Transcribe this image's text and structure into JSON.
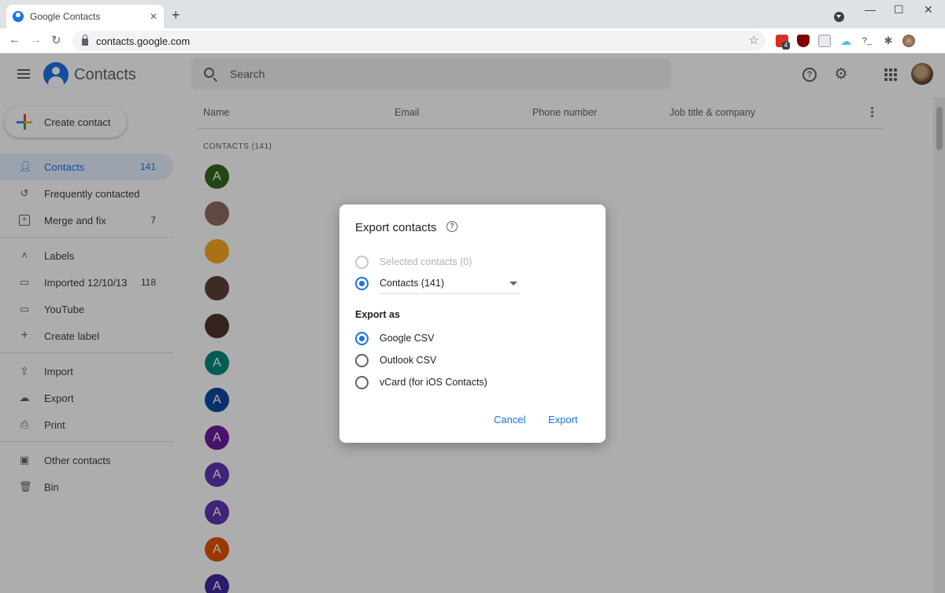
{
  "browser": {
    "tab_title": "Google Contacts",
    "tab_close": "✕",
    "new_tab": "+",
    "url": "contacts.google.com",
    "win_min": "—",
    "win_max": "☐",
    "win_close": "✕",
    "ext_badge": "4"
  },
  "header": {
    "app_name": "Contacts",
    "search_placeholder": "Search"
  },
  "sidebar": {
    "create_label": "Create contact",
    "items": [
      {
        "label": "Contacts",
        "count": "141"
      },
      {
        "label": "Frequently contacted",
        "count": ""
      },
      {
        "label": "Merge and fix",
        "count": "7"
      },
      {
        "label": "Labels",
        "count": ""
      },
      {
        "label": "Imported 12/10/13",
        "count": "118"
      },
      {
        "label": "YouTube",
        "count": ""
      },
      {
        "label": "Create label",
        "count": ""
      },
      {
        "label": "Import",
        "count": ""
      },
      {
        "label": "Export",
        "count": ""
      },
      {
        "label": "Print",
        "count": ""
      },
      {
        "label": "Other contacts",
        "count": ""
      },
      {
        "label": "Bin",
        "count": ""
      }
    ]
  },
  "list": {
    "columns": [
      "Name",
      "Email",
      "Phone number",
      "Job title & company"
    ],
    "section_title": "CONTACTS (141)",
    "avatars": [
      {
        "letter": "A",
        "color": "#33691e"
      },
      {
        "letter": "",
        "color": "#8d6e63"
      },
      {
        "letter": "",
        "color": "#f9a825"
      },
      {
        "letter": "",
        "color": "#5d4037"
      },
      {
        "letter": "",
        "color": "#4e342e"
      },
      {
        "letter": "A",
        "color": "#00897b"
      },
      {
        "letter": "A",
        "color": "#0d47a1"
      },
      {
        "letter": "A",
        "color": "#6a1b9a"
      },
      {
        "letter": "A",
        "color": "#5e35b1"
      },
      {
        "letter": "A",
        "color": "#5e35b1"
      },
      {
        "letter": "A",
        "color": "#e65100"
      },
      {
        "letter": "A",
        "color": "#4527a0"
      }
    ]
  },
  "dialog": {
    "title": "Export contacts",
    "help_glyph": "?",
    "option_selected": "Selected contacts (0)",
    "option_contacts": "Contacts (141)",
    "export_as_label": "Export as",
    "formats": [
      "Google CSV",
      "Outlook CSV",
      "vCard (for iOS Contacts)"
    ],
    "cancel": "Cancel",
    "export": "Export"
  }
}
